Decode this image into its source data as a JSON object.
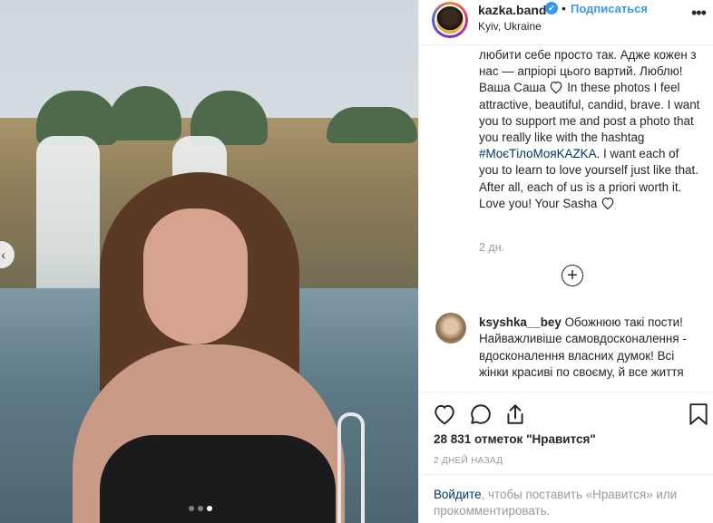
{
  "post": {
    "username": "kazka.band",
    "separator": "•",
    "follow_label": "Подписаться",
    "location": "Kyiv, Ukraine",
    "more_label": "•••",
    "verified_mark": "✔"
  },
  "caption": {
    "text_before": "любити себе просто так. Адже кожен з нас — апріорі цього вартий. Люблю! Ваша Саша ",
    "text_middle": " In these photos I feel attractive, beautiful, candid, brave. I want you to support me and post a photo that you really like with the hashtag ",
    "hashtag": "#МоєТілоМояKAZKA",
    "text_after": ". I want each of you to learn to love yourself just like that. After all, each of us is a priori worth it. Love you! Your Sasha ",
    "time": "2 дн."
  },
  "load_more_label": "+",
  "comment": {
    "username": "ksyshka__bey",
    "text": " Обожнюю такі пости! Найважливіше самовдосконалення - вдосконалення власних думок! Всі жінки красиві по своєму, й все життя"
  },
  "actions": {
    "likes": "28 831 отметок \"Нравится\"",
    "date": "2 ДНЕЙ НАЗАД",
    "login_link": "Войдите",
    "login_rest": ", чтобы поставить «Нравится» или прокомментировать."
  },
  "carousel": {
    "prev_label": "‹",
    "dot_count": 3,
    "active_dot": 3
  },
  "icons": [
    "heart-icon",
    "comment-icon",
    "share-icon",
    "bookmark-icon",
    "verified-badge-icon",
    "more-options-icon",
    "plus-circle-icon",
    "chevron-left-icon"
  ],
  "colors": {
    "link_blue": "#3897f0",
    "hashtag_navy": "#003569",
    "muted_gray": "#999999",
    "text": "#262626"
  }
}
